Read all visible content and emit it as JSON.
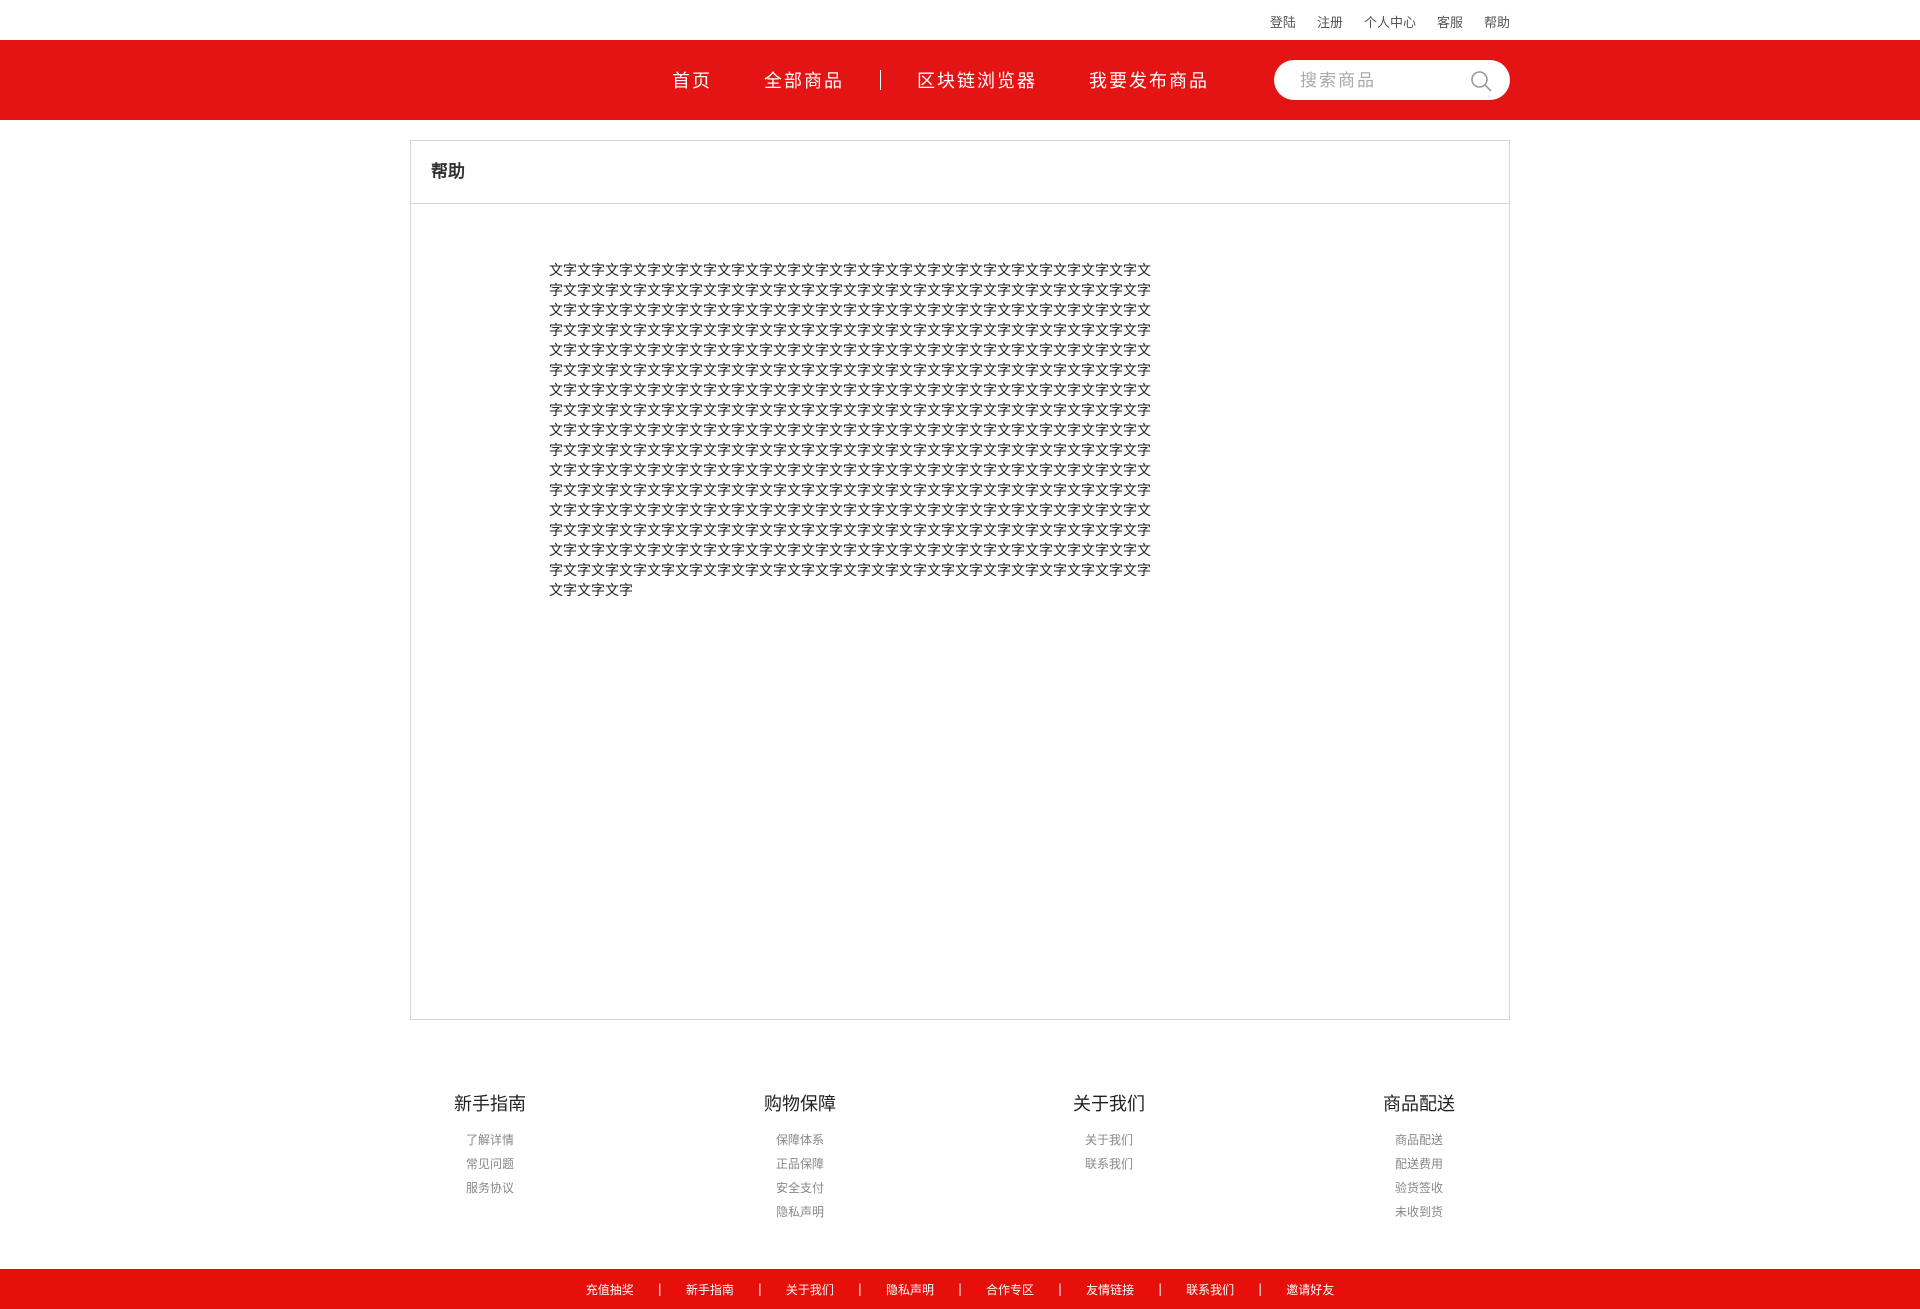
{
  "top_links": [
    "登陆",
    "注册",
    "个人中心",
    "客服",
    "帮助"
  ],
  "nav": {
    "items": [
      "首页",
      "全部商品",
      "区块链浏览器",
      "我要发布商品"
    ],
    "separator": "|"
  },
  "search": {
    "placeholder": "搜索商品",
    "icon": "search-icon"
  },
  "panel": {
    "title": "帮助",
    "body": "文字文字文字文字文字文字文字文字文字文字文字文字文字文字文字文字文字文字文字文字文字文字文字文字文字文字文字文字文字文字文字文字文字文字文字文字文字文字文字文字文字文字文字文字文字文字文字文字文字文字文字文字文字文字文字文字文字文字文字文字文字文字文字文字文字文字文字文字文字文字文字文字文字文字文字文字文字文字文字文字文字文字文字文字文字文字文字文字文字文字文字文字文字文字文字文字文字文字文字文字文字文字文字文字文字文字文字文字文字文字文字文字文字文字文字文字文字文字文字文字文字文字文字文字文字文字文字文字文字文字文字文字文字文字文字文字文字文字文字文字文字文字文字文字文字文字文字文字文字文字文字文字文字文字文字文字文字文字文字文字文字文字文字文字文字文字文字文字文字文字文字文字文字文字文字文字文字文字文字文字文字文字文字文字文字文字文字文字文字文字文字文字文字文字文字文字文字文字文字文字文字文字文字文字文字文字文字文字文字文字文字文字文字文字文字文字文字文字文字文字文字文字文字文字文字文字文字文字文字文字文字文字文字文字文字文字文字文字文字文字文字文字文字文字文字文字文字文字文字文字文字文字文字文字文字文字文字文字文字文字文字文字文字文字文字文字文字文字文字文字文字文字文字文字文字文字文字文字文字文字文字文字文字文字文字文字文字文字文字文字文字文字文字文字文字文字文字文字文字文字文字文字文字文字文字文字文字文字文字文字文字文字文字文字文字文字文字文字文字文字文字文字文字文字文字文字文字文字文字文字文字文字文字文字文字文字文字文字文字文字文字文字文字文字文字文字文字"
  },
  "footer": {
    "columns": [
      {
        "title": "新手指南",
        "links": [
          "了解详情",
          "常见问题",
          "服务协议"
        ]
      },
      {
        "title": "购物保障",
        "links": [
          "保障体系",
          "正品保障",
          "安全支付",
          "隐私声明"
        ]
      },
      {
        "title": "关于我们",
        "links": [
          "关于我们",
          "联系我们"
        ]
      },
      {
        "title": "商品配送",
        "links": [
          "商品配送",
          "配送费用",
          "验货签收",
          "未收到货"
        ]
      }
    ]
  },
  "bottom_links": {
    "items": [
      "充值抽奖",
      "新手指南",
      "关于我们",
      "隐私声明",
      "合作专区",
      "友情链接",
      "联系我们",
      "邀请好友"
    ],
    "separator": "|"
  },
  "colors": {
    "brand_red": "#e41414",
    "bottom_red": "#e60f0a"
  }
}
